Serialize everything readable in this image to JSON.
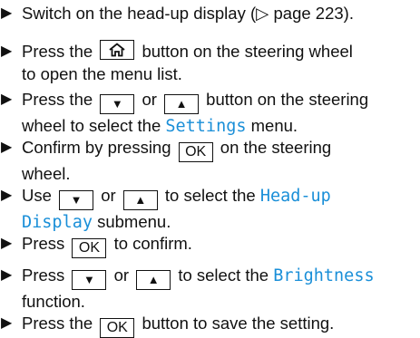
{
  "colors": {
    "text": "#111111",
    "menu_accent": "#1a8fd8",
    "background": "#ffffff"
  },
  "marker_glyph": "▶",
  "icons": {
    "home": "home-icon",
    "down": "down-arrow-icon",
    "up": "up-arrow-icon"
  },
  "keys": {
    "down": "▼",
    "up": "▲",
    "ok": "OK"
  },
  "steps": [
    {
      "l1": "Switch on the head-up display (▷ page 223)."
    },
    {
      "a": "Press the",
      "b": "button on the steering wheel",
      "l2": "to open the menu list."
    },
    {
      "a": "Press the",
      "b": "or",
      "c": "button on the steering",
      "l2a": "wheel to select the",
      "menu": "Settings",
      "l2b": "menu."
    },
    {
      "a": "Confirm by pressing",
      "b": "on the steering",
      "l2": "wheel."
    },
    {
      "a": "Use",
      "b": "or",
      "c": "to select the",
      "menu1": "Head-up",
      "menu2": "Display",
      "l2b": "submenu."
    },
    {
      "a": "Press",
      "b": "to confirm."
    },
    {
      "a": "Press",
      "b": "or",
      "c": "to select the",
      "menu": "Brightness",
      "l2": "function."
    },
    {
      "a": "Press the",
      "b": "button to save the setting."
    }
  ]
}
